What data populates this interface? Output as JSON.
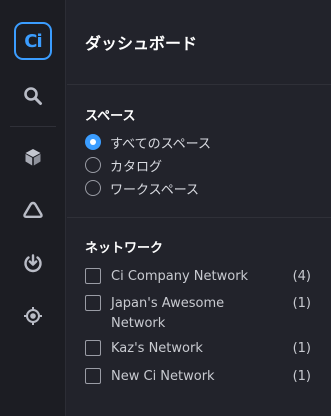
{
  "sidebar": {
    "logo_text": "Ci",
    "items": [
      {
        "icon": "search-icon"
      },
      {
        "icon": "cube-icon"
      },
      {
        "icon": "triangle-icon"
      },
      {
        "icon": "download-icon"
      },
      {
        "icon": "target-icon"
      }
    ]
  },
  "dashboard": {
    "title": "ダッシュボード"
  },
  "spaces": {
    "title": "スペース",
    "options": [
      {
        "label": "すべてのスペース",
        "selected": true
      },
      {
        "label": "カタログ",
        "selected": false
      },
      {
        "label": "ワークスペース",
        "selected": false
      }
    ]
  },
  "networks": {
    "title": "ネットワーク",
    "items": [
      {
        "label": "Ci Company Network",
        "count": "(4)"
      },
      {
        "label": "Japan's Awesome Network",
        "count": "(1)"
      },
      {
        "label": "Kaz's Network",
        "count": "(1)"
      },
      {
        "label": "New Ci Network",
        "count": "(1)"
      }
    ]
  },
  "colors": {
    "accent": "#3b9dff",
    "background": "#22232b",
    "rail": "#1c1d23"
  }
}
